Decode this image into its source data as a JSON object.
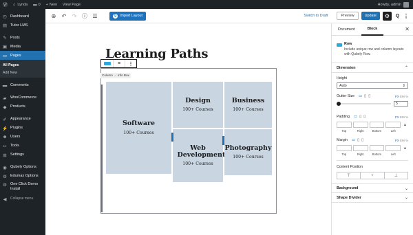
{
  "adminbar": {
    "site_name": "Lynda",
    "comments_count": "0",
    "new_label": "New",
    "view_page": "View Page",
    "howdy": "Howdy, admin"
  },
  "sidebar": {
    "items_top": [
      {
        "label": "Dashboard",
        "icon": "dashboard-icon",
        "glyph": "◴"
      },
      {
        "label": "Tutor LMS",
        "icon": "tutor-icon",
        "glyph": "▤"
      }
    ],
    "items_mid": [
      {
        "label": "Posts",
        "icon": "pin-icon",
        "glyph": "✎"
      },
      {
        "label": "Media",
        "icon": "media-icon",
        "glyph": "▣"
      },
      {
        "label": "Pages",
        "icon": "pages-icon",
        "glyph": "▭"
      }
    ],
    "pages_sub": [
      "All Pages",
      "Add New"
    ],
    "items_bottom": [
      {
        "label": "Comments",
        "icon": "comments-icon",
        "glyph": "▬"
      },
      {
        "label": "WooCommerce",
        "icon": "woocommerce-icon",
        "glyph": "▰"
      },
      {
        "label": "Products",
        "icon": "products-icon",
        "glyph": "◆"
      },
      {
        "label": "Appearance",
        "icon": "appearance-icon",
        "glyph": "✐"
      },
      {
        "label": "Plugins",
        "icon": "plugins-icon",
        "glyph": "⚡"
      },
      {
        "label": "Users",
        "icon": "users-icon",
        "glyph": "☻"
      },
      {
        "label": "Tools",
        "icon": "tools-icon",
        "glyph": "✂"
      },
      {
        "label": "Settings",
        "icon": "settings-icon",
        "glyph": "⊞"
      },
      {
        "label": "Qubely Options",
        "icon": "qubely-icon",
        "glyph": "◉"
      },
      {
        "label": "Edumax Options",
        "icon": "edumax-icon",
        "glyph": "⚙"
      },
      {
        "label": "One Click Demo Install",
        "icon": "demo-install-icon",
        "glyph": "⚙"
      },
      {
        "label": "Collapse menu",
        "icon": "collapse-icon",
        "glyph": "◀"
      }
    ]
  },
  "toolbar": {
    "import_label": "Import Layout",
    "switch_draft": "Switch to Draft",
    "preview": "Preview",
    "update": "Update"
  },
  "editor": {
    "title": "Learning Paths",
    "breadcrumb": "Column → Info Box",
    "cards": [
      {
        "title": "Software",
        "count": "100+ Courses"
      },
      {
        "title": "Design",
        "count": "100+ Courses"
      },
      {
        "title": "Business",
        "count": "100+ Courses"
      },
      {
        "title": "Web Development",
        "count": "100+ Courses"
      },
      {
        "title": "Photography",
        "count": "100+ Courses"
      }
    ]
  },
  "panel": {
    "tabs": [
      "Document",
      "Block"
    ],
    "block_name": "Row",
    "block_desc": "Include unique row and column layouts with Qubely Row.",
    "dimension": "Dimension",
    "height_label": "Height",
    "height_value": "Auto",
    "gutter_label": "Gutter Size",
    "unit_px": "PX",
    "unit_em": "EM",
    "unit_pct": "%",
    "gutter_value": "5",
    "padding_label": "Padding",
    "margin_label": "Margin",
    "quad_labels": [
      "Top",
      "Right",
      "Bottom",
      "Left"
    ],
    "content_position": "Content Position",
    "background": "Background",
    "shape_divider": "Shape Divider"
  },
  "colors": {
    "accent": "#2271b1",
    "card_bg": "#c9d6e2",
    "admin_dark": "#1d2327"
  }
}
